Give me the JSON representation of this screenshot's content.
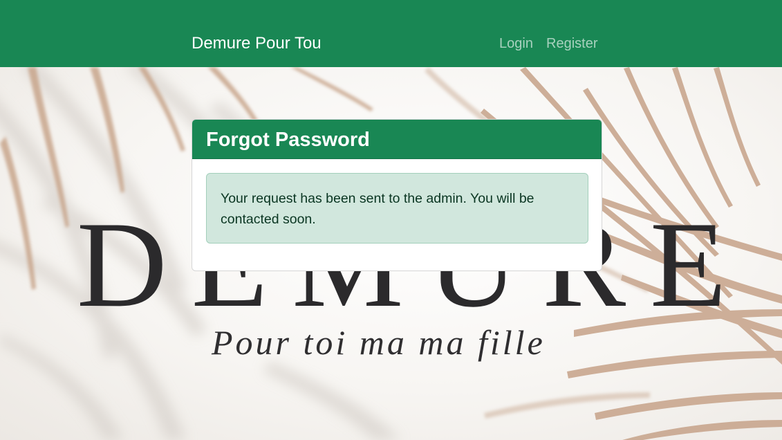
{
  "navbar": {
    "brand": "Demure Pour Tou",
    "links": [
      {
        "label": "Login"
      },
      {
        "label": "Register"
      }
    ]
  },
  "hero": {
    "word": "DEMURE",
    "tagline": "Pour toi ma ma fille"
  },
  "card": {
    "title": "Forgot Password",
    "alert_message": "Your request has been sent to the admin. You will be contacted soon."
  },
  "colors": {
    "primary": "#198754",
    "alert_bg": "#d1e7dd",
    "alert_border": "#a3cfbb",
    "alert_text": "#0a3622",
    "frond": "#c6a48a"
  }
}
